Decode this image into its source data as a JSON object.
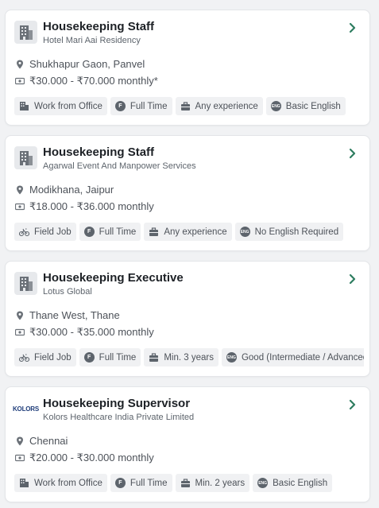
{
  "accent_color": "#2e7d60",
  "jobs": [
    {
      "title": "Housekeeping Staff",
      "company": "Hotel Mari Aai Residency",
      "location": "Shukhapur Gaon, Panvel",
      "salary": "₹30.000 - ₹70.000 monthly*",
      "logo": "building-icon",
      "tags": [
        {
          "icon": "office-icon",
          "label": "Work from Office"
        },
        {
          "icon": "fulltime-icon",
          "label": "Full Time"
        },
        {
          "icon": "briefcase-icon",
          "label": "Any experience"
        },
        {
          "icon": "english-icon",
          "label": "Basic English"
        }
      ]
    },
    {
      "title": "Housekeeping Staff",
      "company": "Agarwal Event And Manpower Services",
      "location": "Modikhana, Jaipur",
      "salary": "₹18.000 - ₹36.000 monthly",
      "logo": "building-icon",
      "tags": [
        {
          "icon": "bike-icon",
          "label": "Field Job"
        },
        {
          "icon": "fulltime-icon",
          "label": "Full Time"
        },
        {
          "icon": "briefcase-icon",
          "label": "Any experience"
        },
        {
          "icon": "english-icon",
          "label": "No English Required"
        }
      ]
    },
    {
      "title": "Housekeeping Executive",
      "company": "Lotus Global",
      "location": "Thane West, Thane",
      "salary": "₹30.000 - ₹35.000 monthly",
      "logo": "building-icon",
      "tags": [
        {
          "icon": "bike-icon",
          "label": "Field Job"
        },
        {
          "icon": "fulltime-icon",
          "label": "Full Time"
        },
        {
          "icon": "briefcase-icon",
          "label": "Min. 3 years"
        },
        {
          "icon": "english-icon",
          "label": "Good (Intermediate / Advanced"
        }
      ]
    },
    {
      "title": "Housekeeping Supervisor",
      "company": "Kolors Healthcare India Private Limited",
      "location": "Chennai",
      "salary": "₹20.000 - ₹30.000 monthly",
      "logo": "kolors-logo",
      "logo_text": "KOLORS",
      "tags": [
        {
          "icon": "office-icon",
          "label": "Work from Office"
        },
        {
          "icon": "fulltime-icon",
          "label": "Full Time"
        },
        {
          "icon": "briefcase-icon",
          "label": "Min. 2 years"
        },
        {
          "icon": "english-icon",
          "label": "Basic English"
        }
      ]
    }
  ]
}
